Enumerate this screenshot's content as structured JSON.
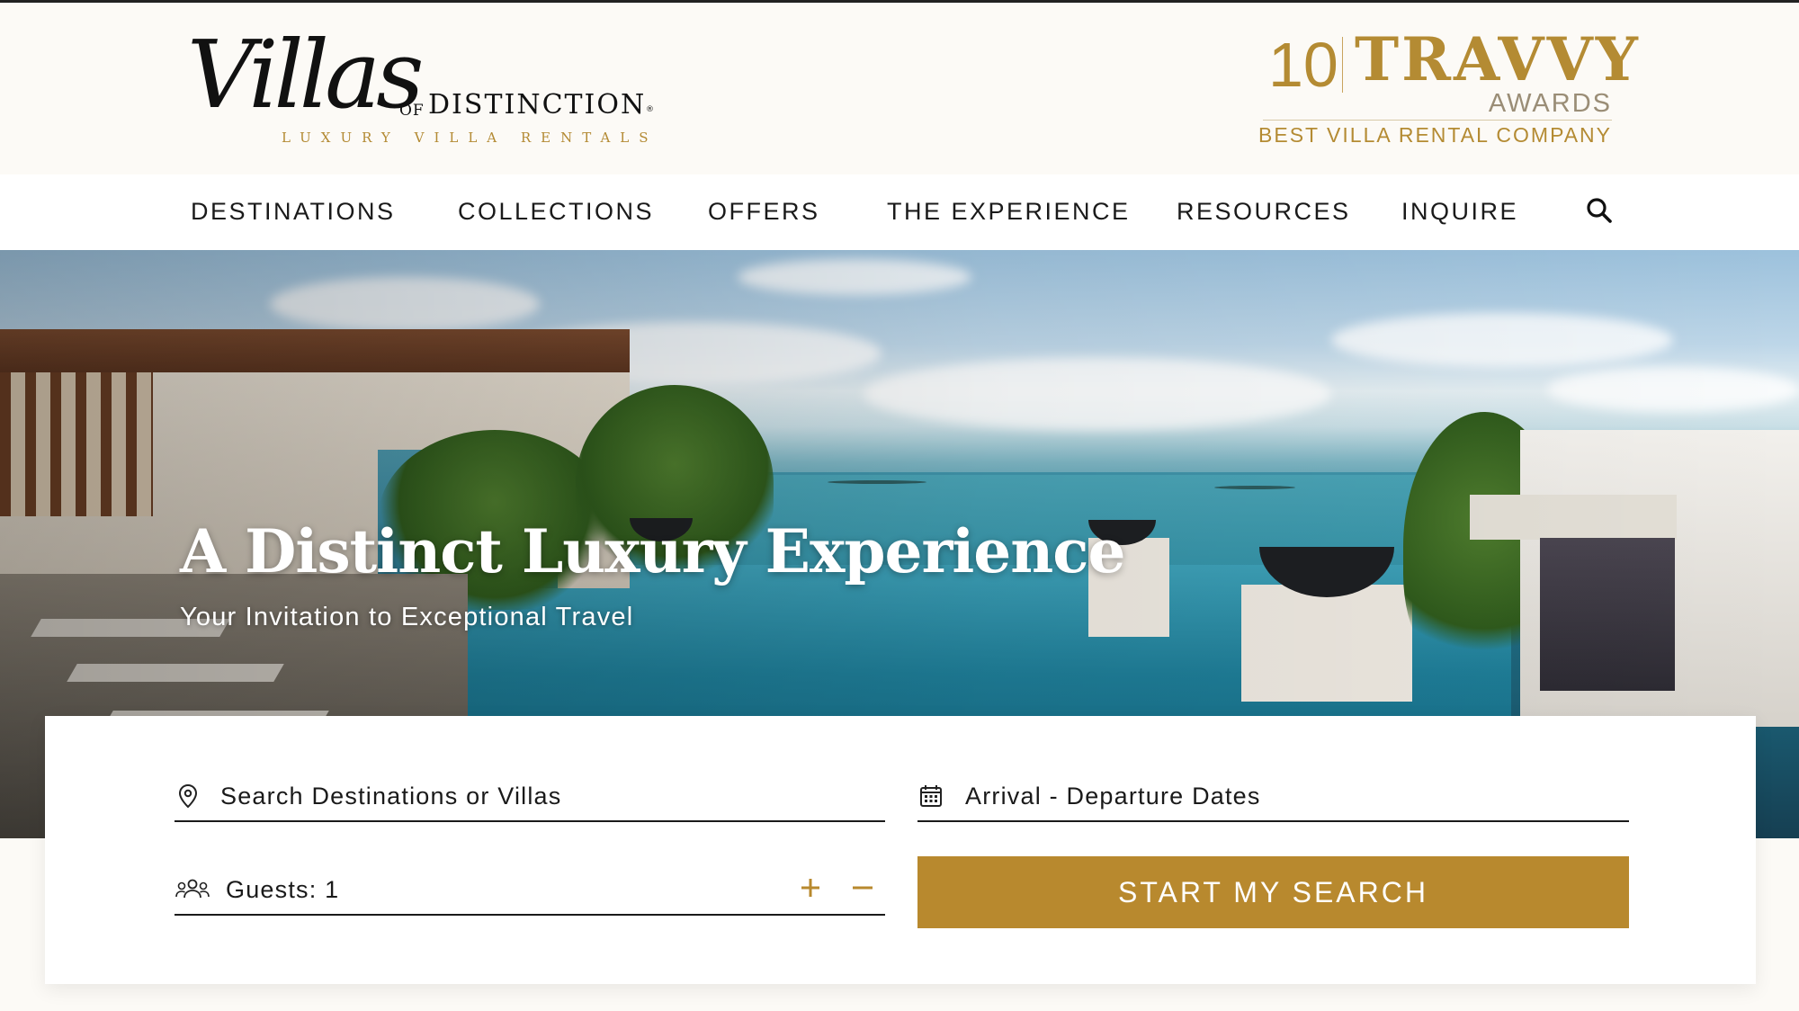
{
  "brand": {
    "logo_script": "Villas",
    "logo_of": "OF",
    "logo_name": "DISTINCTION",
    "logo_registered": "®",
    "logo_tagline": "LUXURY VILLA RENTALS"
  },
  "award": {
    "number": "10",
    "name": "TRAVVY",
    "subtitle": "AWARDS",
    "line": "BEST VILLA RENTAL COMPANY"
  },
  "nav": {
    "items": [
      {
        "label": "DESTINATIONS"
      },
      {
        "label": "COLLECTIONS"
      },
      {
        "label": "OFFERS"
      },
      {
        "label": "THE EXPERIENCE"
      },
      {
        "label": "RESOURCES"
      },
      {
        "label": "INQUIRE"
      }
    ],
    "search_icon": "search-icon"
  },
  "hero": {
    "title": "A Distinct Luxury Experience",
    "subtitle": "Your Invitation to Exceptional Travel"
  },
  "search": {
    "destination_placeholder": "Search Destinations or Villas",
    "dates_placeholder": "Arrival - Departure Dates",
    "guests_label": "Guests: 1",
    "increment": "+",
    "decrement": "−",
    "button_label": "START MY SEARCH"
  },
  "colors": {
    "gold": "#b8892e",
    "text": "#1a1a1a",
    "header_bg": "#fcfaf6"
  }
}
